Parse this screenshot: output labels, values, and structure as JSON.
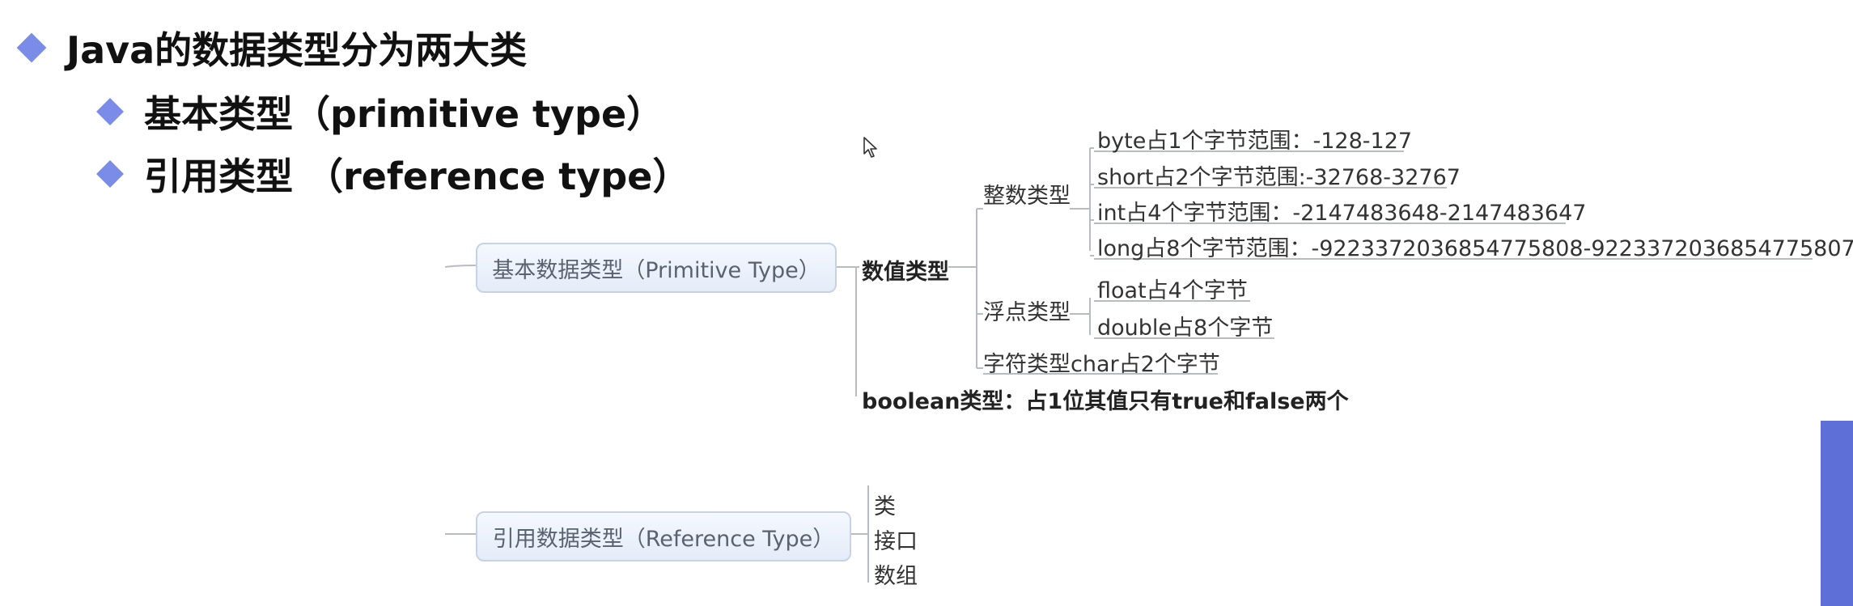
{
  "bullets": {
    "b1": "Java的数据类型分为两大类",
    "b2": "基本类型（primitive type）",
    "b3": "引用类型 （reference type）"
  },
  "diagram": {
    "primitive_node": "基本数据类型（Primitive Type）",
    "numeric": "数值类型",
    "integer": "整数类型",
    "int_items": [
      "byte占1个字节范围：-128-127",
      "short占2个字节范围:-32768-32767",
      "int占4个字节范围：-2147483648-2147483647",
      "long占8个字节范围：-9223372036854775808-9223372036854775807"
    ],
    "float_type": "浮点类型",
    "float_items": [
      "float占4个字节",
      "double占8个字节"
    ],
    "char_item": "字符类型char占2个字节",
    "boolean_item": "boolean类型：占1位其值只有true和false两个",
    "reference_node": "引用数据类型（Reference Type）",
    "ref_items": [
      "类",
      "接口",
      "数组"
    ]
  },
  "colors": {
    "accent": "#7b8be8",
    "node_border": "#c6d3e4",
    "line": "#b8bcc2"
  }
}
